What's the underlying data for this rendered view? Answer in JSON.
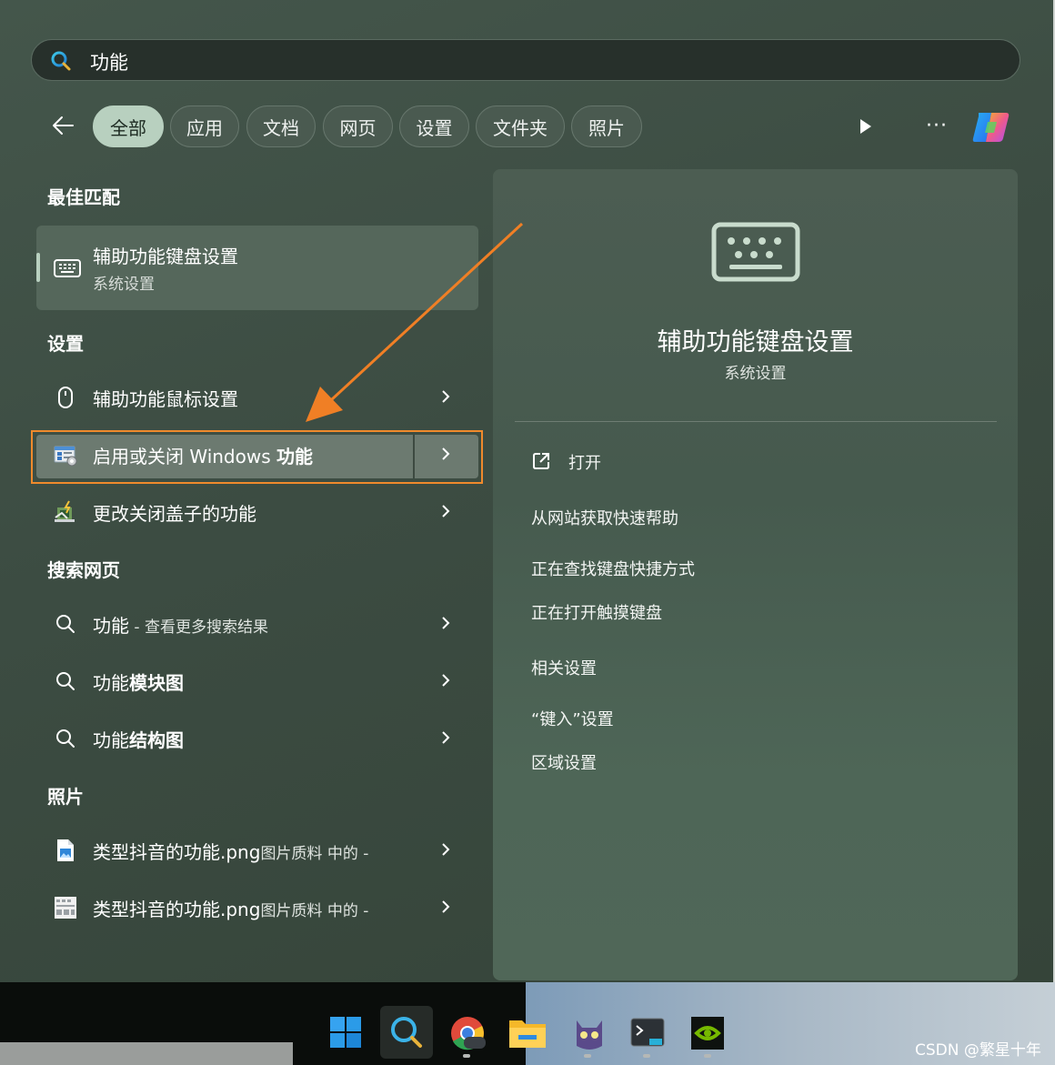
{
  "search": {
    "query": "功能"
  },
  "filters": [
    "全部",
    "应用",
    "文档",
    "网页",
    "设置",
    "文件夹",
    "照片"
  ],
  "sections": {
    "best_match": "最佳匹配",
    "settings": "设置",
    "web": "搜索网页",
    "photos": "照片"
  },
  "best_match": {
    "title": "辅助功能键盘设置",
    "subtitle": "系统设置"
  },
  "settings_items": [
    {
      "label": "辅助功能鼠标设置"
    },
    {
      "label": "启用或关闭 Windows ",
      "label_bold": "功能"
    },
    {
      "label": "更改关闭盖子的功能"
    }
  ],
  "web_items": [
    {
      "label": "功能",
      "suffix": " - 查看更多搜索结果"
    },
    {
      "label": "功能",
      "label_bold": "模块图"
    },
    {
      "label": "功能",
      "label_bold": "结构图"
    }
  ],
  "photo_items": [
    {
      "label": "类型抖音的功能.png",
      "suffix": "图片质料 中的 -"
    },
    {
      "label": "类型抖音的功能.png",
      "suffix": "图片质料 中的 -"
    }
  ],
  "detail": {
    "title": "辅助功能键盘设置",
    "subtitle": "系统设置",
    "open": "打开",
    "help": "从网站获取快速帮助",
    "link1": "正在查找键盘快捷方式",
    "link2": "正在打开触摸键盘",
    "related": "相关设置",
    "link3": "“键入”设置",
    "link4": "区域设置"
  },
  "more_label": "···",
  "watermark": "CSDN @繁星十年",
  "colors": {
    "accent_chip": "#b8d0bf",
    "highlight_border": "#f08a2c",
    "arrow": "#f07f25"
  }
}
